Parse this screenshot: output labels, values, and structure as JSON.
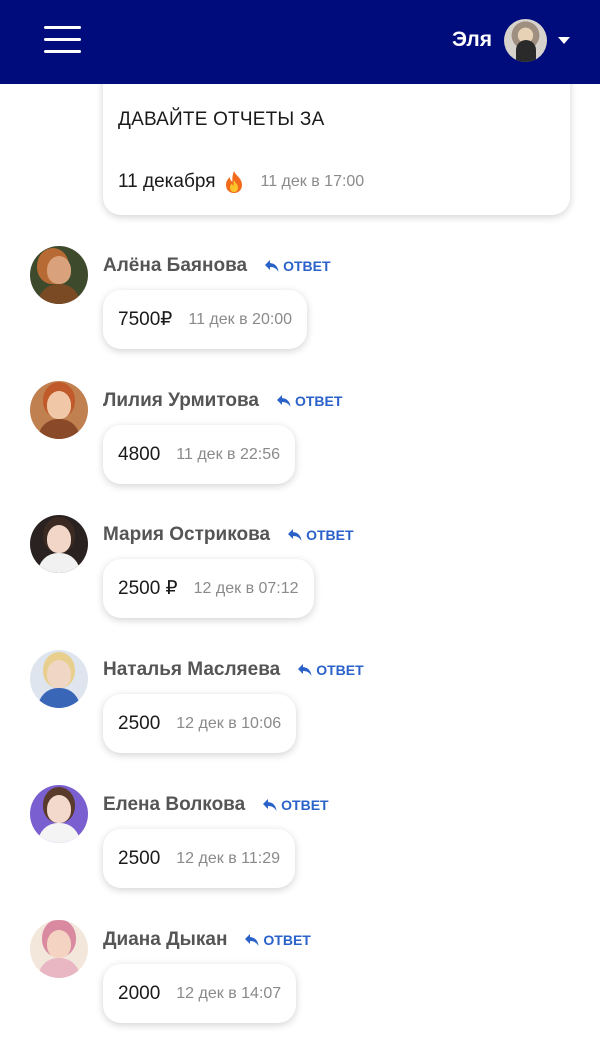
{
  "header": {
    "user_name": "Эля",
    "colors": {
      "bar": "#000b7c",
      "text": "#ffffff"
    },
    "icons": {
      "menu": "hamburger-menu-icon",
      "dropdown": "caret-down-icon"
    }
  },
  "top_message": {
    "line1": "ДАВАЙТЕ ОТЧЕТЫ ЗА",
    "line2": "11 декабря",
    "emoji": "fire-icon",
    "time": "11 дек в 17:00"
  },
  "reply_label": "ОТВЕТ",
  "accent_color": "#2a62c9",
  "comments": [
    {
      "author": "Алёна Баянова",
      "text": "7500₽",
      "time": "11 дек в 20:00"
    },
    {
      "author": "Лилия Урмитова",
      "text": "4800",
      "time": "11 дек в 22:56"
    },
    {
      "author": "Мария Острикова",
      "text": "2500 ₽",
      "time": "12 дек в 07:12"
    },
    {
      "author": "Наталья Масляева",
      "text": "2500",
      "time": "12 дек в 10:06"
    },
    {
      "author": "Елена Волкова",
      "text": "2500",
      "time": "12 дек в 11:29"
    },
    {
      "author": "Диана Дыкан",
      "text": "2000",
      "time": "12 дек в 14:07"
    }
  ]
}
